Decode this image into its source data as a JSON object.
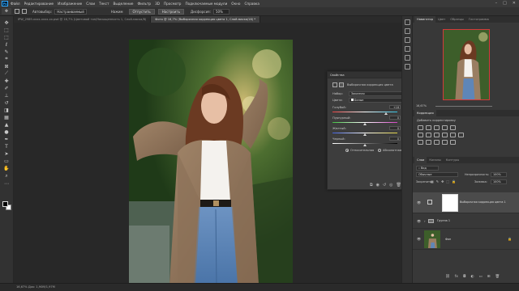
{
  "app": {
    "logo": "Ps"
  },
  "menu": [
    "Файл",
    "Редактирование",
    "Изображение",
    "Слои",
    "Текст",
    "Выделение",
    "Фильтр",
    "3D",
    "Просмотр",
    "Подключаемые модули",
    "Окно",
    "Справка"
  ],
  "window_controls": [
    "–",
    "□",
    "✕"
  ],
  "options": {
    "tool_icon": "move-tool-icon",
    "auto_label": "Автовыбор:",
    "auto_value": "Настраиваемый",
    "opacity_label": "Нажим",
    "btn1": "Отпустить",
    "btn2": "Настроить",
    "extra_label": "Дисфорсия:",
    "extra_value": "50%"
  },
  "tabs": [
    {
      "label": "IPW_2989-xxxx-xxxx-xx.psd @ 16,7% (Цветовой тон/Насыщенность 1, Слой-маска/8)",
      "active": false
    },
    {
      "label": "Фото @ 16,7% (Выборочная коррекция цвета 1, Слой-маска/16) *",
      "active": true
    }
  ],
  "properties": {
    "title": "Свойства",
    "subtitle": "Выборочная коррекция цвета",
    "preset_label": "Набор:",
    "preset_value": "Заказная",
    "colors_label": "Цвета:",
    "colors_value": "Белые",
    "sliders": [
      {
        "label": "Голубой:",
        "value": "+18",
        "unit": "%",
        "pos": 0.82
      },
      {
        "label": "Пурпурный:",
        "value": "0",
        "unit": "%",
        "pos": 0.5
      },
      {
        "label": "Желтый:",
        "value": "0",
        "unit": "%",
        "pos": 0.5
      },
      {
        "label": "Черный:",
        "value": "0",
        "unit": "%",
        "pos": 0.5
      }
    ],
    "mode_relative": "Относительная",
    "mode_absolute": "Абсолютная"
  },
  "right": {
    "nav_tabs": [
      "Навигатор",
      "Цвет",
      "Образцы",
      "Гистограмма"
    ],
    "zoom": "16,67%",
    "adjust_title": "Коррекция",
    "adjust_sub": "Добавить корректировку",
    "layer_tabs": [
      "Слои",
      "Каналы",
      "Контуры"
    ],
    "kind": "Вид",
    "blend": "Обычные",
    "opacity_label": "Непрозрачность:",
    "opacity_value": "100%",
    "lock_label": "Закрепить:",
    "fill_label": "Заливка:",
    "fill_value": "100%",
    "layers": [
      {
        "name": "Выборочная коррекция цвета 1",
        "type": "adjustment"
      },
      {
        "name": "Группа 1",
        "type": "group"
      },
      {
        "name": "Фон",
        "type": "image"
      }
    ]
  },
  "status": "16,67%   Док: 1,90M/1,97M",
  "colors": {
    "accent": "#31a8ff",
    "nav_frame": "#d43a3a"
  }
}
